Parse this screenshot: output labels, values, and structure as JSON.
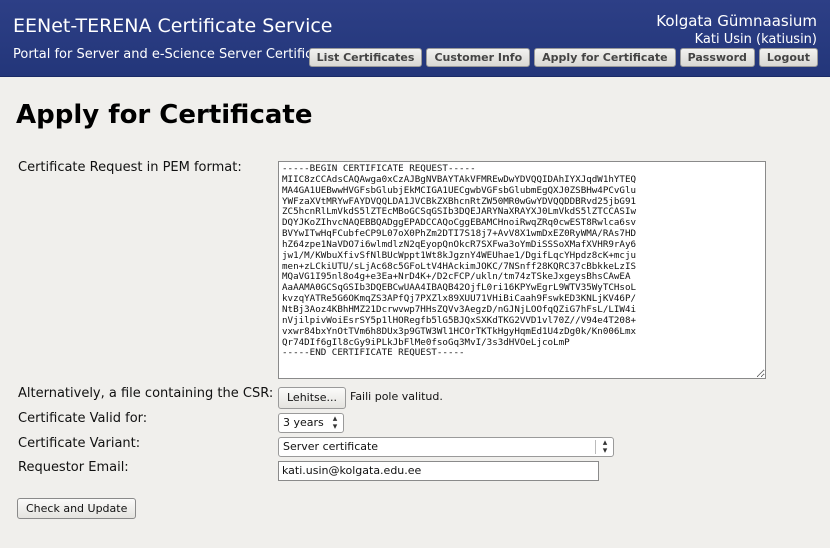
{
  "header": {
    "service_title": "EENet-TERENA Certificate Service",
    "service_subtitle": "Portal for Server and e-Science Server Certificates",
    "organization": "Kolgata Gümnaasium",
    "user": "Kati Usin (katiusin)",
    "nav": {
      "list_certificates": "List Certificates",
      "customer_info": "Customer Info",
      "apply_for_certificate": "Apply for Certificate",
      "password": "Password",
      "logout": "Logout"
    }
  },
  "page": {
    "title": "Apply for Certificate"
  },
  "form": {
    "pem_label": "Certificate Request in PEM format:",
    "pem_value": "-----BEGIN CERTIFICATE REQUEST-----\nMIIC8zCCAdsCAQAwga0xCzAJBgNVBAYTAkVFMREwDwYDVQQIDAhIYXJqdW1hYTEQ\nMA4GA1UEBwwHVGFsbGlubjEkMCIGA1UECgwbVGFsbGlubmEgQXJ0ZSBHw4PCvGlu\nYWFzaXVtMRYwFAYDVQQLDA1JVCBkZXBhcnRtZW50MR0wGwYDVQQDDBRvd25jbG91\nZC5hcnRlLmVkdS5lZTEcMBoGCSqGSIb3DQEJARYNaXRAYXJ0LmVkdS5lZTCCASIw\nDQYJKoZIhvcNAQEBBQADggEPADCCAQoCggEBAMCHnoiRwqZRq0cwEST8Rwlca6sv\nBVYwITwHqFCubfeCP9L07oX0PhZm2DTI7S18j7+AvV8X1wmDxEZ0RyWMA/RAs7HD\nhZ64zpe1NaVDO7i6wlmdlzN2qEyopQnOkcR7SXFwa3oYmDiSSSoXMafXVHR9rAy6\njw1/M/KWbuXfivSfNlBUcWppt1Wt8kJgznY4WEUhae1/DgifLqcYHpdz8cK+mcju\nmen+zLCkiUTU/sLjAc68c5GFoLtV4HAckimJOKC/7NSnff28KQRC37cBbkkeLzIS\nMQaVG1I95nl8o4g+e3Ea+NrD4K+/D2cFCP/ukln/tm74zTSkeJxgeysBhsCAwEA\nAaAAMA0GCSqGSIb3DQEBCwUAA4IBAQB42OjfL0ri16KPYwEgrL9WTV35WyTCHsoL\nkvzqYATRe5G6OKmqZS3APfQj7PXZlx89XUU71VHiBiCaah9FswkED3KNLjKV46P/\nNtBj3Aoz4KBhHMZ21Dcrwvwp7HHsZQVv3AegzD/nGJNjLOOfqQZiG7hFsL/LIW4i\nnVjilpivWoiEsrSY5p1lHORegfb5lG5BJQxSXKdTKG2VVD1vl70Z//V94e4T208+\nvxwr84bxYnOtTVm6h8DUx3p9GTW3Wl1HCOrTKTkHgyHqmEd1U4zDg0k/Kn006Lmx\nQr74DIf6gIl8cGy9iPLkJbFlMe0fsoGq3MvI/3s3dHVOeLjcoLmP\n-----END CERTIFICATE REQUEST-----",
    "file_label": "Alternatively, a file containing the CSR:",
    "file_button": "Lehitse...",
    "file_status": "Faili pole valitud.",
    "valid_label": "Certificate Valid for:",
    "valid_value": "3 years",
    "variant_label": "Certificate Variant:",
    "variant_value": "Server certificate",
    "email_label": "Requestor Email:",
    "email_value": "kati.usin@kolgata.edu.ee",
    "submit_label": "Check and Update"
  },
  "colors": {
    "header_bg": "#25387c",
    "page_bg": "#f0efec"
  },
  "icons": {
    "select_chevron": "up-down-chevron-icon",
    "resize_grip": "resize-grip-icon"
  }
}
